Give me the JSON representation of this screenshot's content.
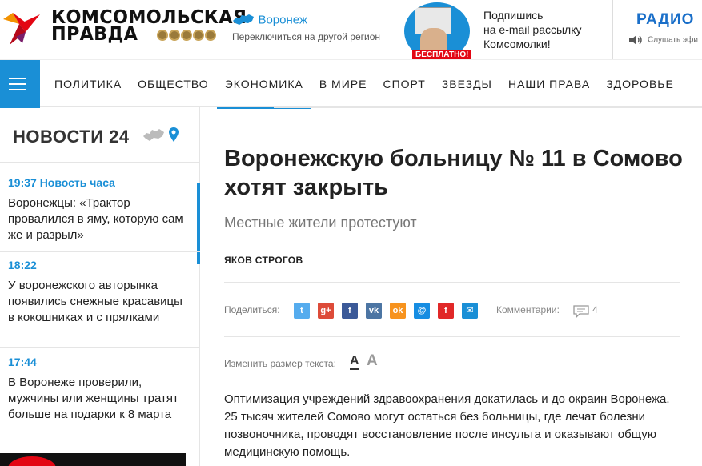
{
  "header": {
    "logo_line1": "КОМСОМОЛЬСКАЯ",
    "logo_line2": "ПРАВДА",
    "region_name": "Воронеж",
    "region_switch": "Переключиться на другой регион",
    "promo_badge": "БЕСПЛАТНО!",
    "subscribe_lines": [
      "Подпишись",
      "на e-mail рассылку",
      "Комсомолки!"
    ],
    "radio_label": "РАДИО",
    "radio_listen": "Слушать эфи"
  },
  "nav": {
    "items": [
      "ПОЛИТИКА",
      "ОБЩЕСТВО",
      "ЭКОНОМИКА",
      "В МИРЕ",
      "СПОРТ",
      "ЗВЕЗДЫ",
      "НАШИ ПРАВА",
      "ЗДОРОВЬЕ"
    ],
    "active": "ЭКОНОМИКА"
  },
  "sidebar": {
    "heading": "НОВОСТИ 24",
    "news": [
      {
        "time": "19:37 Новость часа",
        "title": "Воронежцы: «Трактор провалился в яму, которую сам же и разрыл»"
      },
      {
        "time": "18:22",
        "title": "У воронежского авторынка появились снежные красавицы в кокошниках и с прялками"
      },
      {
        "time": "17:44",
        "title": "В Воронеже проверили, мужчины или женщины тратят больше на подарки к 8 марта"
      }
    ]
  },
  "article": {
    "title": "Воронежскую больницу № 11 в Сомово хотят закрыть",
    "subtitle": "Местные жители протестуют",
    "author": "ЯКОВ СТРОГОВ",
    "share_label": "Поделиться:",
    "share_buttons": [
      {
        "name": "twitter",
        "glyph": "t",
        "color": "#55acee"
      },
      {
        "name": "google-plus",
        "glyph": "g+",
        "color": "#dd4b39"
      },
      {
        "name": "facebook",
        "glyph": "f",
        "color": "#3b5998"
      },
      {
        "name": "vk",
        "glyph": "vk",
        "color": "#4c75a3"
      },
      {
        "name": "odnoklassniki",
        "glyph": "ok",
        "color": "#f7931e"
      },
      {
        "name": "moimir",
        "glyph": "@",
        "color": "#168de2"
      },
      {
        "name": "flipboard",
        "glyph": "f",
        "color": "#e12828"
      },
      {
        "name": "email",
        "glyph": "✉",
        "color": "#1a8fd6"
      }
    ],
    "comments_label": "Комментарии:",
    "comments_count": "4",
    "text_size_label": "Изменить размер текста:",
    "text_size_small": "A",
    "text_size_large": "A",
    "body": "Оптимизация учреждений здравоохранения докатилась и до окраин Воронежа. 25 тысяч жителей Сомово могут остаться без больницы, где лечат болезни позвоночника, проводят восстановление после инсульта и оказывают общую медицинскую помощь."
  }
}
